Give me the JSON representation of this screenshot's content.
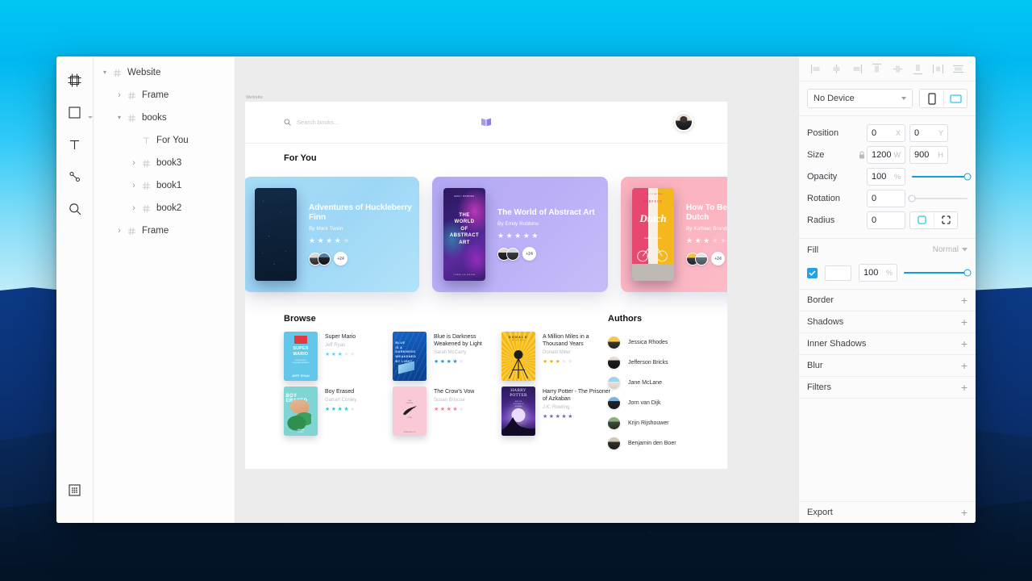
{
  "toolbar": {
    "tools": [
      {
        "name": "artboard-tool",
        "label": "Artboard"
      },
      {
        "name": "shape-tool",
        "label": "Shape"
      },
      {
        "name": "text-tool",
        "label": "Text"
      },
      {
        "name": "pen-tool",
        "label": "Pen"
      },
      {
        "name": "zoom-tool",
        "label": "Zoom"
      }
    ],
    "bottom_tool": {
      "name": "components-tool",
      "label": "Components"
    }
  },
  "layers": {
    "items": [
      {
        "label": "Website",
        "indent": 0,
        "disclosure": "down",
        "type": "frame"
      },
      {
        "label": "Frame",
        "indent": 1,
        "disclosure": "right",
        "type": "frame"
      },
      {
        "label": "books",
        "indent": 1,
        "disclosure": "down",
        "type": "frame"
      },
      {
        "label": "For You",
        "indent": 2,
        "disclosure": "none",
        "type": "text"
      },
      {
        "label": "book3",
        "indent": 2,
        "disclosure": "right",
        "type": "frame"
      },
      {
        "label": "book1",
        "indent": 2,
        "disclosure": "right",
        "type": "frame"
      },
      {
        "label": "book2",
        "indent": 2,
        "disclosure": "right",
        "type": "frame"
      },
      {
        "label": "Frame",
        "indent": 1,
        "disclosure": "right",
        "type": "frame"
      }
    ]
  },
  "canvas": {
    "artboard_label": "Website",
    "site": {
      "search_placeholder": "Search books...",
      "for_you_title": "For You",
      "browse_title": "Browse",
      "authors_title": "Authors",
      "featured": [
        {
          "title": "Adventures of Huckleberry Finn",
          "author": "By Mark Twain",
          "rating": 4,
          "rating_max": 5,
          "more_count": "+24",
          "card_color": "#a5dcf7"
        },
        {
          "title": "The World of Abstract Art",
          "author": "By Emily Robbins",
          "rating": 5,
          "rating_max": 5,
          "more_count": "+24",
          "card_color": "#b3a8f5"
        },
        {
          "title": "How To Be The Perfect Dutch",
          "author": "By Kathian Brands",
          "rating": 3,
          "rating_max": 5,
          "more_count": "+24",
          "card_color": "#fbb1bf"
        }
      ],
      "browse": [
        {
          "title": "Super Mario",
          "author": "Jeff Ryan",
          "rating": 3,
          "rating_max": 5,
          "star_color": "#6dcff6"
        },
        {
          "title": "Blue is Darkness Weakened by Light",
          "author": "Sarah McCarry",
          "rating": 4,
          "rating_max": 5,
          "star_color": "#1e9bd7"
        },
        {
          "title": "A Million Miles in a Thousand Years",
          "author": "Donald Miller",
          "rating": 3,
          "rating_max": 5,
          "star_color": "#f2b705"
        },
        {
          "title": "Boy Erased",
          "author": "Garrart Conley",
          "rating": 4,
          "rating_max": 5,
          "star_color": "#3fc4c4"
        },
        {
          "title": "The Crow's Vow",
          "author": "Susan Briscoe",
          "rating": 4,
          "rating_max": 5,
          "star_color": "#f08098"
        },
        {
          "title": "Harry Potter - The Prisoner of Azkaban",
          "author": "J.K. Rowling",
          "rating": 5,
          "rating_max": 5,
          "star_color": "#7b5fd4"
        }
      ],
      "authors": [
        {
          "name": "Jessica Rhodes"
        },
        {
          "name": "Jefferson Bricks"
        },
        {
          "name": "Jane McLane"
        },
        {
          "name": "Jorn van Dijk"
        },
        {
          "name": "Krijn Rijshouwer"
        },
        {
          "name": "Benjamin den Boer"
        }
      ]
    }
  },
  "inspector": {
    "align_buttons": [
      {
        "name": "align-left-icon"
      },
      {
        "name": "align-center-horizontal-icon"
      },
      {
        "name": "align-right-icon"
      },
      {
        "name": "align-top-icon"
      },
      {
        "name": "align-center-vertical-icon"
      },
      {
        "name": "align-bottom-icon"
      },
      {
        "name": "distribute-horizontal-icon"
      },
      {
        "name": "distribute-vertical-icon"
      }
    ],
    "device": {
      "selected": "No Device",
      "orientation_portrait": "portrait",
      "orientation_landscape": "landscape",
      "active_orientation": "landscape"
    },
    "properties": {
      "position_label": "Position",
      "position_x": "0",
      "position_x_unit": "X",
      "position_y": "0",
      "position_y_unit": "Y",
      "size_label": "Size",
      "size_w": "1200",
      "size_w_unit": "W",
      "size_h": "900",
      "size_h_unit": "H",
      "opacity_label": "Opacity",
      "opacity_value": "100",
      "opacity_unit": "%",
      "opacity_pct": 100,
      "rotation_label": "Rotation",
      "rotation_value": "0",
      "rotation_pct": 0,
      "radius_label": "Radius",
      "radius_value": "0"
    },
    "fill": {
      "label": "Fill",
      "blend_mode": "Normal",
      "enabled": true,
      "color": "#ffffff",
      "opacity_value": "100",
      "opacity_unit": "%",
      "opacity_pct": 100
    },
    "sections": [
      {
        "label": "Border"
      },
      {
        "label": "Shadows"
      },
      {
        "label": "Inner Shadows"
      },
      {
        "label": "Blur"
      },
      {
        "label": "Filters"
      }
    ],
    "export": {
      "label": "Export"
    }
  },
  "colors": {
    "accent": "#0c9fe0",
    "checkbox": "#21a3e5",
    "highlight": "#2ec8e6",
    "wallpaper_sky": "#00c6f5",
    "wallpaper_mountain": "#0c3a86"
  }
}
